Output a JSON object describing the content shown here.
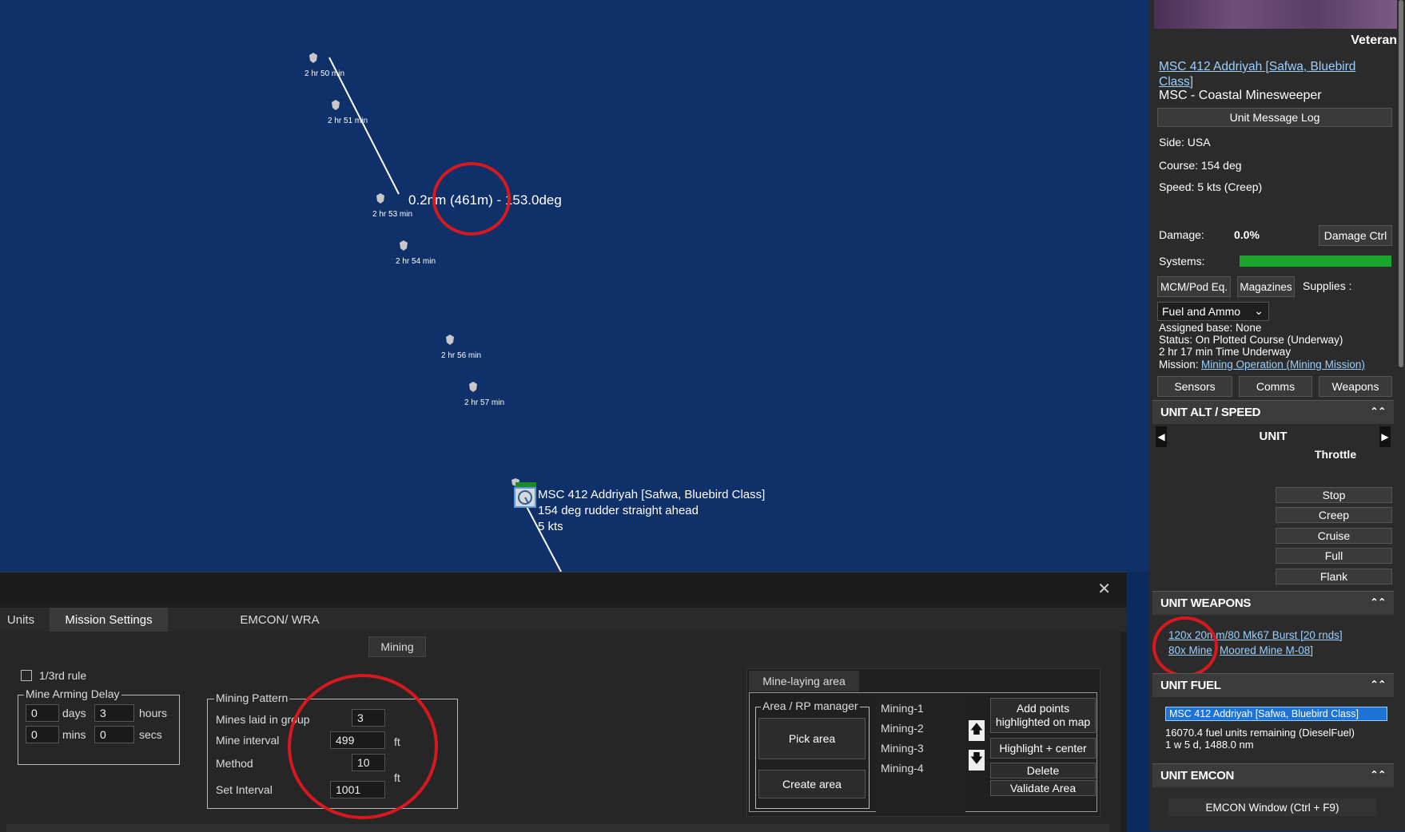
{
  "map": {
    "waypoints": [
      "2 hr 50 min",
      "2 hr 51 min",
      "2 hr 53 min",
      "2 hr 54 min",
      "2 hr 56 min",
      "2 hr 57 min"
    ],
    "measure": "0.2nm (461m) - 153.0deg",
    "unit_label": {
      "name": "MSC 412 Addriyah [Safwa, Bluebird Class]",
      "heading": "154 deg  rudder straight ahead",
      "speed": "5 kts"
    }
  },
  "panel": {
    "rank": "Veteran",
    "unit_link": "MSC 412 Addriyah [Safwa, Bluebird Class]",
    "unit_type": "MSC - Coastal Minesweeper",
    "message_log": "Unit Message Log",
    "side": "Side: USA",
    "course": "Course: 154 deg",
    "speed": "Speed: 5 kts (Creep)",
    "damage_label": "Damage:",
    "damage_value": "0.0%",
    "damage_ctrl": "Damage Ctrl",
    "systems_label": "Systems:",
    "mcm": "MCM/Pod Eq.",
    "magazines": "Magazines",
    "supplies": "Supplies :",
    "supplies_select": "Fuel and Ammo",
    "assigned_base": "Assigned base: None",
    "status": "Status: On Plotted Course (Underway)",
    "time_underway": "2 hr 17 min Time Underway",
    "mission_label": "Mission:",
    "mission_link": "Mining Operation (Mining Mission)",
    "sensors": "Sensors",
    "comms": "Comms",
    "weapons": "Weapons",
    "alt_speed_head": "UNIT ALT / SPEED",
    "unit": "UNIT",
    "throttle": "Throttle",
    "throttle_btns": [
      "Stop",
      "Creep",
      "Cruise",
      "Full",
      "Flank"
    ],
    "weapons_head": "UNIT WEAPONS",
    "weapon1": "120x 20mm/80 Mk67 Burst [20 rnds]",
    "weapon2a": "80x Mine",
    "weapon2b": "Moored Mine M-08]",
    "fuel_head": "UNIT FUEL",
    "fuel_unit": "MSC 412 Addriyah [Safwa, Bluebird Class]",
    "fuel_remaining": "16070.4 fuel units remaining (DieselFuel)",
    "fuel_time": "1 w 5 d, 1488.0 nm",
    "emcon_head": "UNIT EMCON",
    "emcon_btn": "EMCON Window (Ctrl + F9)"
  },
  "dialog": {
    "tabs": [
      "Units",
      "Mission Settings",
      "EMCON/ WRA"
    ],
    "subtab": "Mining",
    "third_rule": "1/3rd rule",
    "arming_legend": "Mine Arming Delay",
    "days_val": "0",
    "days": "days",
    "hours_val": "3",
    "hours": "hours",
    "mins_val": "0",
    "mins": "mins",
    "secs_val": "0",
    "secs": "secs",
    "pattern_legend": "Mining Pattern",
    "mines_in_group": "Mines laid in group",
    "mines_in_group_val": "3",
    "mine_interval": "Mine interval",
    "mine_interval_val": "499",
    "ft": "ft",
    "method": "Method",
    "method_val": "10",
    "set_interval": "Set Interval",
    "set_interval_val": "1001",
    "area_tab": "Mine-laying area",
    "rp_legend": "Area / RP manager",
    "pick_area": "Pick area",
    "create_area": "Create area",
    "areas": [
      "Mining-1",
      "Mining-2",
      "Mining-3",
      "Mining-4"
    ],
    "add_points": "Add points highlighted on map",
    "highlight": "Highlight + center",
    "delete": "Delete",
    "validate": "Validate Area"
  }
}
